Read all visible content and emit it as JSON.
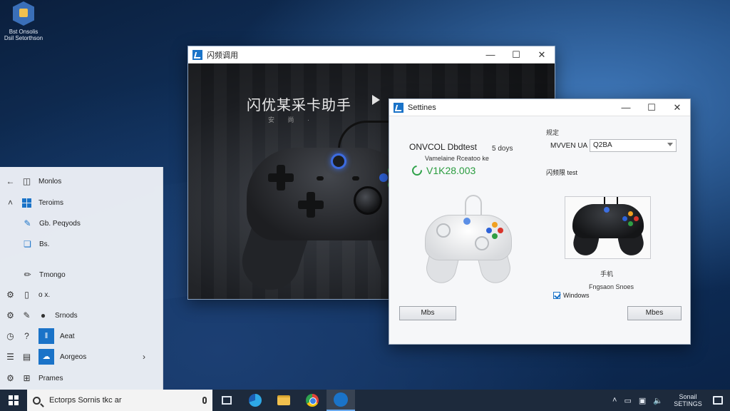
{
  "desktop": {
    "icon_label_line1": "Bst     Onsolis",
    "icon_label_line2": "Dsil Setorthson"
  },
  "main_window": {
    "title": "闪频调用",
    "hero_title": "闪优某采卡助手",
    "hero_subtitle": "安 尚 ·"
  },
  "settings_window": {
    "title": "Settines",
    "device_label": "ONVCOL Dbdtest",
    "days_label": "5 doys",
    "status_label": "Vamelaine Rceatoo ke",
    "version": "V1K28.003",
    "right_top_label": "规定",
    "select_label": "MVVEN UA",
    "select_value": "Q2BA",
    "section_label": "闪频限 test",
    "preview_caption": "手机",
    "preview_sub_caption": "Fngsaon Snoes",
    "checkbox_label": "Windows",
    "button_left": "Mbs",
    "button_right": "Mbes"
  },
  "start_menu": {
    "items": [
      {
        "label": "Monlos"
      },
      {
        "label": "Teroims"
      },
      {
        "label": "Gb.  Peqyods"
      },
      {
        "label": "Bs."
      },
      {
        "label": "Tmongo"
      },
      {
        "label": "o x."
      },
      {
        "label": "Srnods"
      },
      {
        "label": "Aeat"
      },
      {
        "label": "Aorgeos"
      },
      {
        "label": "Prames"
      }
    ]
  },
  "taskbar": {
    "search_placeholder": "Ectorps Sornis tkc ar",
    "clock_line1": "Sonail",
    "clock_line2": "SETINGS"
  },
  "colors": {
    "accent": "#1a73c8",
    "version_green": "#2a9c3f",
    "taskbar": "#1d2a3c"
  }
}
